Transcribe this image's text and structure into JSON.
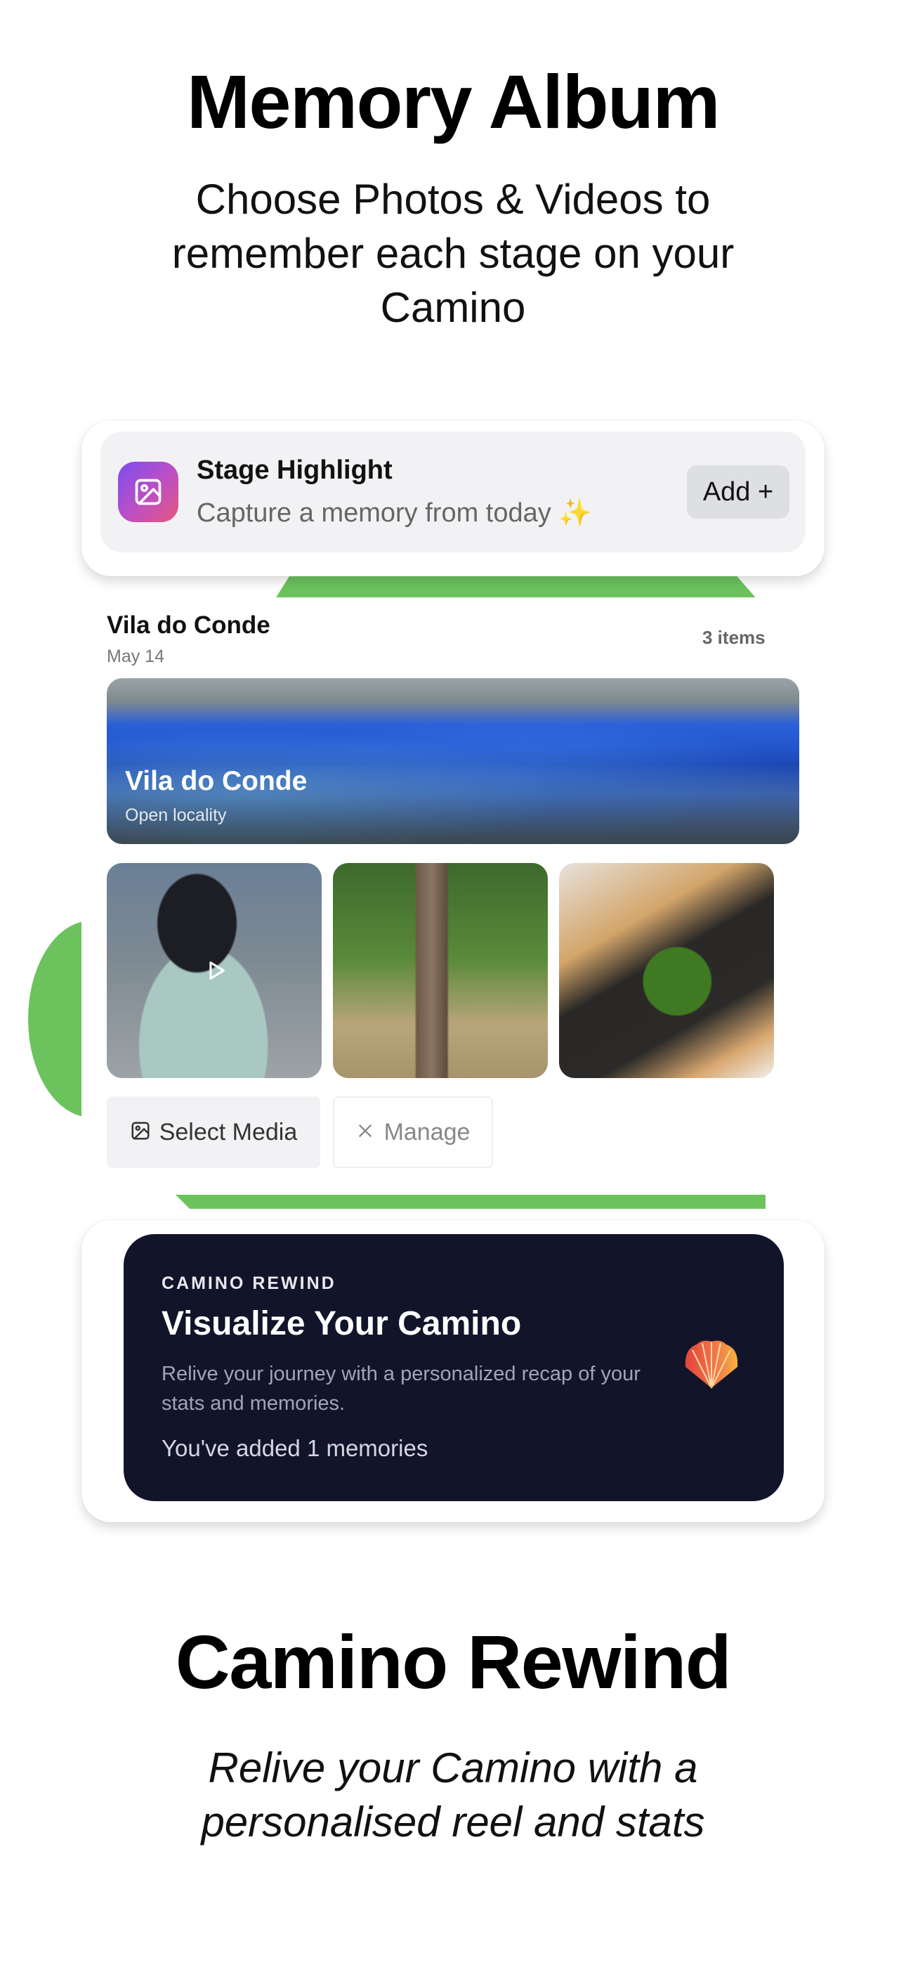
{
  "hero": {
    "title": "Memory Album",
    "subtitle": "Choose Photos & Videos to remember each stage on your Camino"
  },
  "highlight": {
    "title": "Stage Highlight",
    "description": "Capture a memory from today ✨",
    "add_label": "Add +",
    "icon": "image-icon"
  },
  "album": {
    "location_title": "Vila do Conde",
    "date": "May 14",
    "item_count": "3 items",
    "hero_photo": {
      "title": "Vila do Conde",
      "subtitle": "Open locality"
    },
    "thumbnails": [
      {
        "kind": "video",
        "icon": "play-icon"
      },
      {
        "kind": "photo"
      },
      {
        "kind": "photo"
      }
    ],
    "select_media_label": "Select Media",
    "manage_label": "Manage"
  },
  "rewind": {
    "eyebrow": "CAMINO REWIND",
    "title": "Visualize Your Camino",
    "description": "Relive your journey with a personalized recap of your stats and memories.",
    "count_text": "You've added 1 memories",
    "icon": "scallop-shell-icon"
  },
  "bottom": {
    "title": "Camino Rewind",
    "subtitle": "Relive your Camino with a personalised reel and stats"
  },
  "colors": {
    "accent_green": "#6cc35d",
    "rewind_background": "#12142a",
    "highlight_gradient_start": "#7b4ef0",
    "highlight_gradient_end": "#e7577f"
  }
}
